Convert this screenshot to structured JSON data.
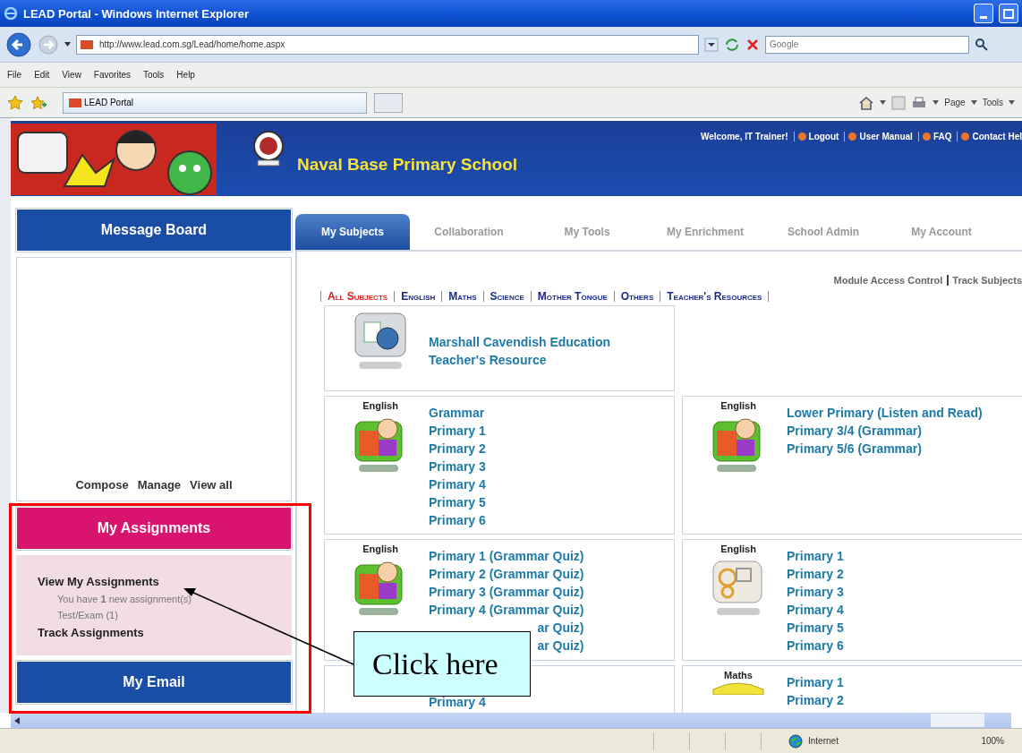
{
  "window": {
    "title": "LEAD Portal - Windows Internet Explorer"
  },
  "address_bar": {
    "url": "http://www.lead.com.sg/Lead/home/home.aspx"
  },
  "search": {
    "placeholder": "Google"
  },
  "menu": [
    "File",
    "Edit",
    "View",
    "Favorites",
    "Tools",
    "Help"
  ],
  "favorites_bar": {
    "tab": "LEAD Portal",
    "commands": [
      "Page",
      "Tools"
    ]
  },
  "header": {
    "school": "Naval Base Primary School",
    "welcome": "Welcome, IT Trainer!",
    "links": [
      "Logout",
      "User Manual",
      "FAQ",
      "Contact Hel"
    ]
  },
  "sidebar": {
    "message_board": {
      "title": "Message Board",
      "actions": [
        "Compose",
        "Manage",
        "View all"
      ]
    },
    "assignments": {
      "title": "My Assignments",
      "items": [
        {
          "kind": "heading",
          "text": "**View My Assignments**"
        },
        {
          "kind": "detail",
          "text": "You have **1** new assignment(s)"
        },
        {
          "kind": "detail",
          "text": "Test/Exam (1)"
        },
        {
          "kind": "heading",
          "text": "**Track Assignments**"
        }
      ]
    },
    "email": {
      "title": "My Email"
    }
  },
  "tabs": [
    {
      "label": "My Subjects",
      "selected": true
    },
    {
      "label": "Collaboration",
      "selected": false
    },
    {
      "label": "My Tools",
      "selected": false
    },
    {
      "label": "My Enrichment",
      "selected": false
    },
    {
      "label": "School Admin",
      "selected": false
    },
    {
      "label": "My Account",
      "selected": false
    }
  ],
  "top_links": [
    "Module Access Control",
    "Track Subjects"
  ],
  "subjects": [
    {
      "label": "All Subjects",
      "selected": true
    },
    {
      "label": "English",
      "selected": false
    },
    {
      "label": "Maths",
      "selected": false
    },
    {
      "label": "Science",
      "selected": false
    },
    {
      "label": "Mother Tongue",
      "selected": false
    },
    {
      "label": "Others",
      "selected": false
    },
    {
      "label": "Teacher's Resources",
      "selected": false
    }
  ],
  "tiles": [
    {
      "kind": "resource",
      "links": [
        "Marshall Cavendish Education",
        "Teacher's Resource"
      ]
    },
    {
      "kind": "cartoon",
      "subject": "English",
      "links": [
        "Grammar",
        "Primary 1",
        "Primary 2",
        "Primary 3",
        "Primary 4",
        "Primary 5",
        "Primary 6"
      ]
    },
    {
      "kind": "cartoon",
      "subject": "English",
      "links": [
        "Lower Primary (Listen and Read)",
        "Primary 3/4 (Grammar)",
        "Primary 5/6 (Grammar)"
      ]
    },
    {
      "kind": "cartoon",
      "subject": "English",
      "links": [
        "Primary 1 (Grammar Quiz)",
        "Primary 2 (Grammar Quiz)",
        "Primary 3 (Grammar Quiz)",
        "Primary 4 (Grammar Quiz)"
      ],
      "covered_links": [
        "ar Quiz)",
        "ar Quiz)"
      ]
    },
    {
      "kind": "word",
      "subject": "English",
      "links": [
        "Primary 1",
        "Primary 2",
        "Primary 3",
        "Primary 4",
        "Primary 5",
        "Primary 6"
      ]
    },
    {
      "kind": "grey",
      "links": [
        "Primary 4"
      ]
    },
    {
      "kind": "maths",
      "subject": "Maths",
      "links": [
        "Primary 1",
        "Primary 2"
      ]
    }
  ],
  "status_bar": {
    "zone": "Internet",
    "zoom": "100%"
  },
  "callout": {
    "text": "Click here"
  }
}
